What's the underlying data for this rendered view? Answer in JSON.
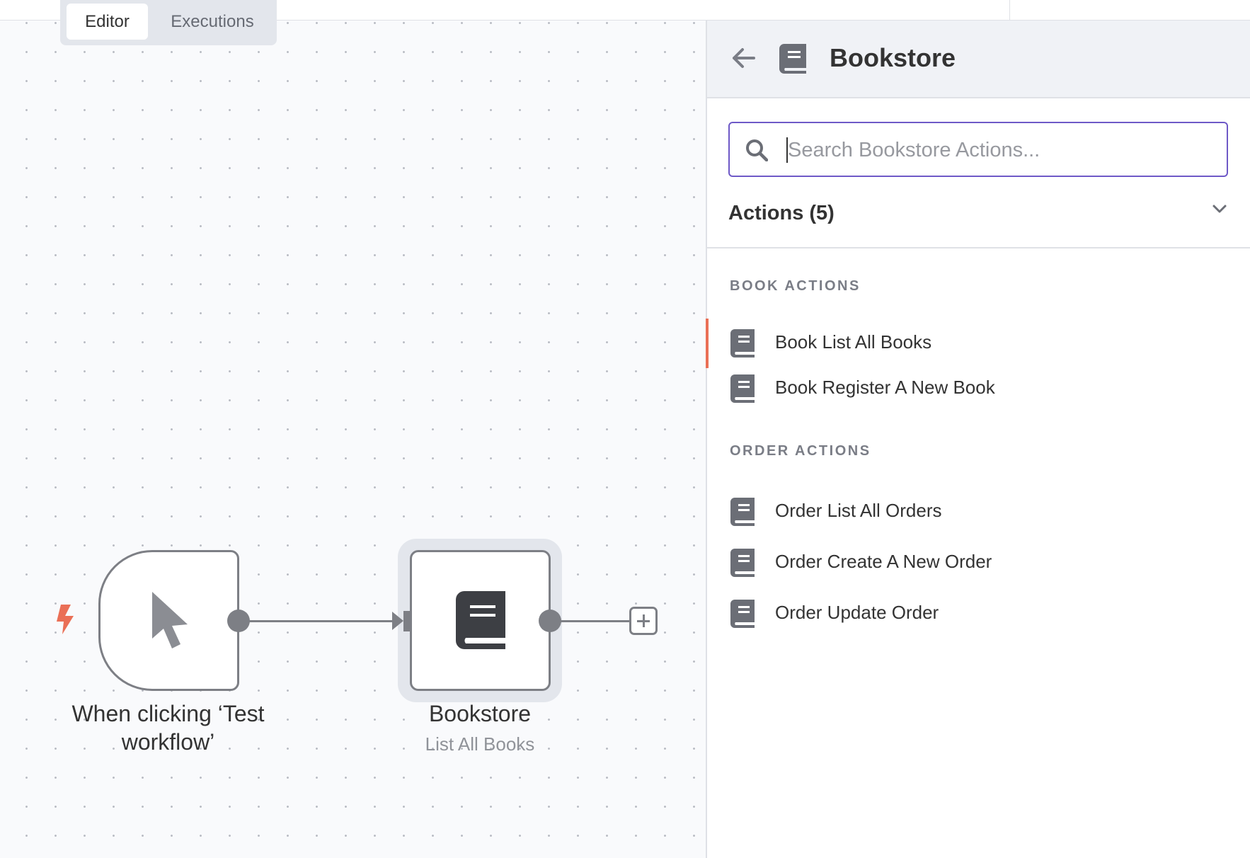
{
  "tabs": {
    "editor": "Editor",
    "executions": "Executions"
  },
  "canvas": {
    "trigger_node": {
      "title_line1": "When clicking ‘Test",
      "title_line2": "workflow’"
    },
    "bookstore_node": {
      "title": "Bookstore",
      "subtitle": "List All Books"
    }
  },
  "panel": {
    "title": "Bookstore",
    "search": {
      "placeholder": "Search Bookstore Actions...",
      "value": ""
    },
    "actions_header": "Actions (5)",
    "sections": [
      {
        "label": "BOOK ACTIONS",
        "items": [
          {
            "label": "Book List All Books"
          },
          {
            "label": "Book Register A New Book"
          }
        ]
      },
      {
        "label": "ORDER ACTIONS",
        "items": [
          {
            "label": "Order List All Orders"
          },
          {
            "label": "Order Create A New Order"
          },
          {
            "label": "Order Update Order"
          }
        ]
      }
    ]
  },
  "colors": {
    "accent": "#6e59c7",
    "trigger": "#ea6f56",
    "node_border": "#7d7f85",
    "icon_dark": "#3d3f44"
  }
}
